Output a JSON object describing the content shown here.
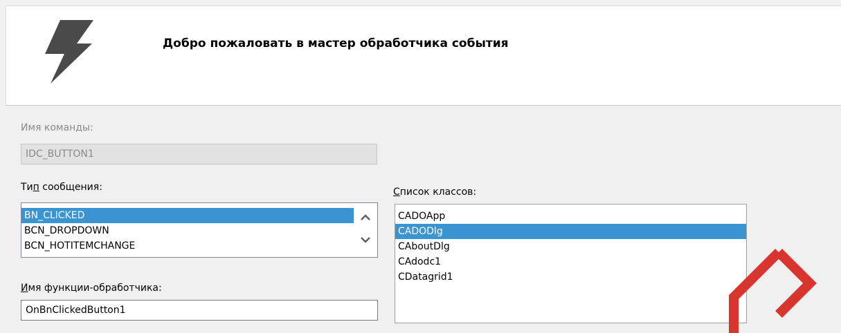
{
  "header": {
    "title": "Добро пожаловать в мастер обработчика события",
    "icon": "lightning-bolt-icon"
  },
  "command": {
    "label": "Имя команды:",
    "value": "IDC_BUTTON1"
  },
  "message_type": {
    "label_pre": "Ти",
    "label_mnemonic": "п",
    "label_post": " сообщения:",
    "items": [
      "BN_CLICKED",
      "BCN_DROPDOWN",
      "BCN_HOTITEMCHANGE"
    ],
    "selected": "BN_CLICKED"
  },
  "class_list": {
    "label_mnemonic": "С",
    "label_post": "писок классов:",
    "items": [
      "CADOApp",
      "CADODlg",
      "CAboutDlg",
      "CAdodc1",
      "CDatagrid1"
    ],
    "selected": "CADODlg"
  },
  "handler": {
    "label_mnemonic": "И",
    "label_post": "мя функции-обработчика:",
    "value": "OnBnClickedButton1"
  },
  "colors": {
    "selection": "#3a94d1",
    "watermark": "#d9352f"
  }
}
